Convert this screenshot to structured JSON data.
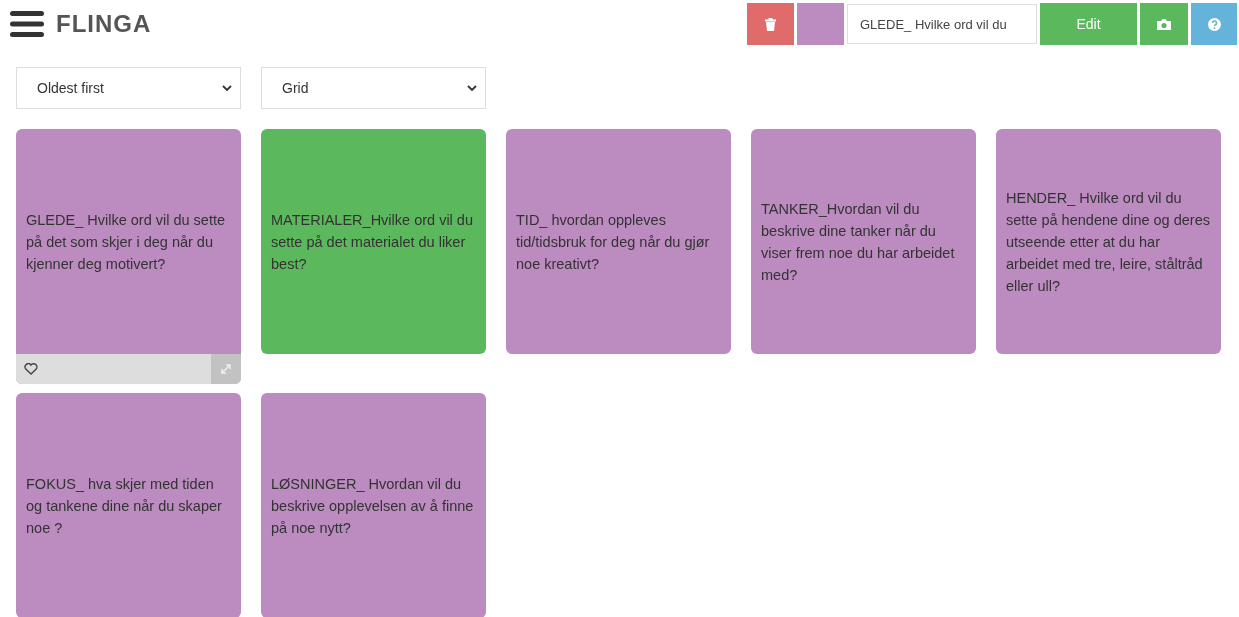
{
  "header": {
    "logo": "FLINGA"
  },
  "toolbar": {
    "color": "#bc8bc0",
    "title_field": {
      "value": "GLEDE_ Hvilke ord vil du"
    },
    "edit_button": "Edit"
  },
  "filters": [
    {
      "value": "Oldest first"
    },
    {
      "value": "Grid"
    }
  ],
  "cards": [
    {
      "text": "GLEDE_ Hvilke ord vil du sette på det som skjer i deg når du kjenner deg motivert?",
      "color": "#bc8bc0",
      "hovered": true
    },
    {
      "text": "MATERIALER_Hvilke ord vil du sette på det materialet du liker best?",
      "color": "#5cb85c",
      "hovered": false
    },
    {
      "text": "TID_ hvordan oppleves tid/tidsbruk for deg når du gjør noe kreativt?",
      "color": "#bc8bc0",
      "hovered": false
    },
    {
      "text": "TANKER_Hvordan vil du beskrive dine tanker når du viser frem noe du har arbeidet med?",
      "color": "#bc8bc0",
      "hovered": false
    },
    {
      "text": "HENDER_ Hvilke ord vil du sette på hendene dine og deres utseende etter at du har arbeidet med tre, leire, ståltråd eller ull?",
      "color": "#bc8bc0",
      "hovered": false
    },
    {
      "text": "FOKUS_ hva skjer med tiden og tankene dine når du skaper noe ?",
      "color": "#bc8bc0",
      "hovered": false
    },
    {
      "text": "LØSNINGER_ Hvordan vil du beskrive opplevelsen av å finne på noe nytt?",
      "color": "#bc8bc0",
      "hovered": false
    }
  ]
}
